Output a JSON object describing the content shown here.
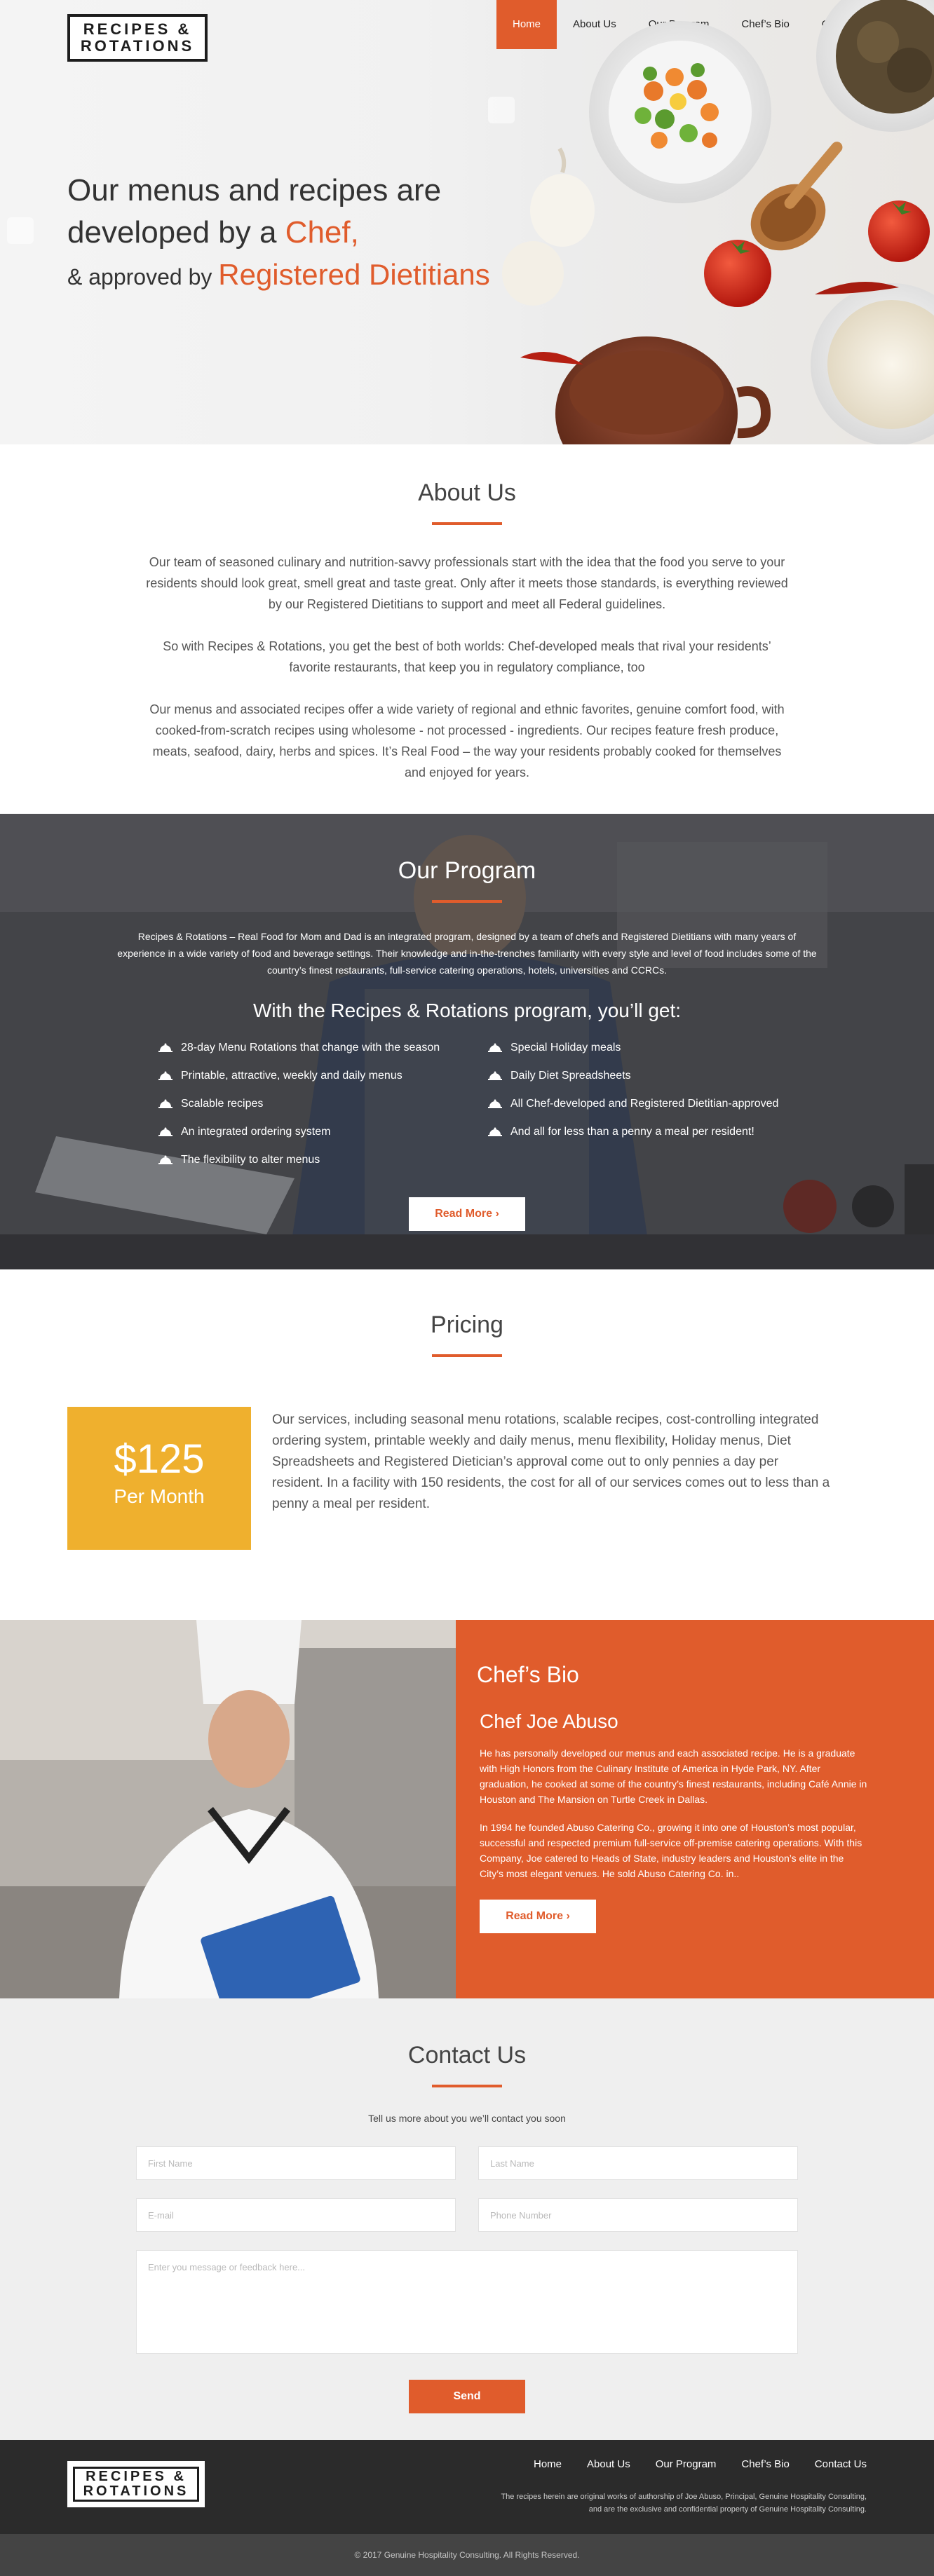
{
  "brand": {
    "logo_line1": "RECIPES &",
    "logo_line2": "ROTATIONS"
  },
  "nav": [
    {
      "label": "Home"
    },
    {
      "label": "About Us"
    },
    {
      "label": "Our Program"
    },
    {
      "label": "Chef’s Bio"
    },
    {
      "label": "Contact Us"
    }
  ],
  "hero": {
    "line1": "Our menus and recipes are",
    "line2_prefix": "developed by a ",
    "line2_accent": "Chef,",
    "line3_prefix": "& approved by ",
    "line3_accent": "Registered Dietitians"
  },
  "about": {
    "title": "About Us",
    "paragraphs": [
      "Our team of seasoned culinary and nutrition-savvy professionals start with the idea that the food you serve to your residents should look great, smell great and taste great. Only after it meets those standards, is everything reviewed by our Registered Dietitians to support and meet all Federal guidelines.",
      "So with Recipes & Rotations, you get the best of both worlds: Chef-developed meals that rival your residents’ favorite restaurants, that keep you in regulatory compliance, too",
      "Our menus and associated recipes offer a wide variety of regional and ethnic favorites, genuine comfort food, with cooked-from-scratch recipes using wholesome - not processed - ingredients. Our recipes feature fresh produce, meats, seafood, dairy, herbs and spices. It’s Real Food – the way your residents probably cooked for themselves and enjoyed for years."
    ]
  },
  "program": {
    "title": "Our Program",
    "intro": "Recipes & Rotations – Real Food for Mom and Dad is an integrated program, designed by a team of chefs and Registered Dietitians with many years of experience in a wide variety of food and beverage settings. Their knowledge and in-the-trenches familiarity with every style and level of food includes some of the country’s finest restaurants, full-service catering operations, hotels, universities and CCRCs.",
    "subtitle": "With the Recipes & Rotations program, you’ll get:",
    "features": [
      "28-day Menu Rotations that change with the season",
      "Special Holiday meals",
      "Printable, attractive, weekly and daily menus",
      "Daily Diet Spreadsheets",
      "Scalable recipes",
      "All Chef-developed and Registered Dietitian-approved",
      "An integrated ordering system",
      "And all for less than a penny a meal per resident!",
      "The flexibility to alter menus"
    ],
    "button": "Read More"
  },
  "pricing": {
    "title": "Pricing",
    "amount": "$125",
    "period": "Per Month",
    "description": "Our services, including seasonal menu rotations, scalable recipes, cost-controlling integrated ordering system, printable weekly and daily menus, menu flexibility, Holiday menus, Diet Spreadsheets and Registered Dietician’s approval come out to only pennies a day per resident. In a facility with 150 residents, the cost for all of our services comes out to less than a penny a meal per resident."
  },
  "chef": {
    "title": "Chef’s Bio",
    "name": "Chef Joe Abuso",
    "p1": "He has personally developed our menus and each associated recipe. He is a graduate with High Honors from the Culinary Institute of America in Hyde Park, NY. After graduation, he cooked at some of the country’s finest restaurants, including Café Annie in Houston and The Mansion on Turtle Creek in Dallas.",
    "p2": "In 1994 he founded Abuso Catering Co., growing it into one of Houston’s most popular, successful and respected premium full-service off-premise catering operations. With this Company, Joe catered to Heads of State, industry leaders and Houston’s elite in the City’s most elegant venues. He sold Abuso Catering Co. in..",
    "button": "Read More"
  },
  "contact": {
    "title": "Contact Us",
    "lede": "Tell us more about you we’ll contact you soon",
    "first_name": "First Name",
    "last_name": "Last Name",
    "email": "E-mail",
    "phone": "Phone Number",
    "message": "Enter you message or feedback here...",
    "send": "Send"
  },
  "footer": {
    "nav": [
      "Home",
      "About Us",
      "Our Program",
      "Chef’s Bio",
      "Contact Us"
    ],
    "note1": "The recipes herein are original works of authorship of Joe Abuso, Principal, Genuine Hospitality Consulting,",
    "note2": "and are the exclusive and confidential property of Genuine Hospitality Consulting.",
    "copyright": "© 2017 Genuine Hospitality Consulting. All Rights Reserved."
  },
  "colors": {
    "accent": "#e05c2c",
    "price_box": "#efb02e",
    "footer": "#2b2b2b"
  }
}
